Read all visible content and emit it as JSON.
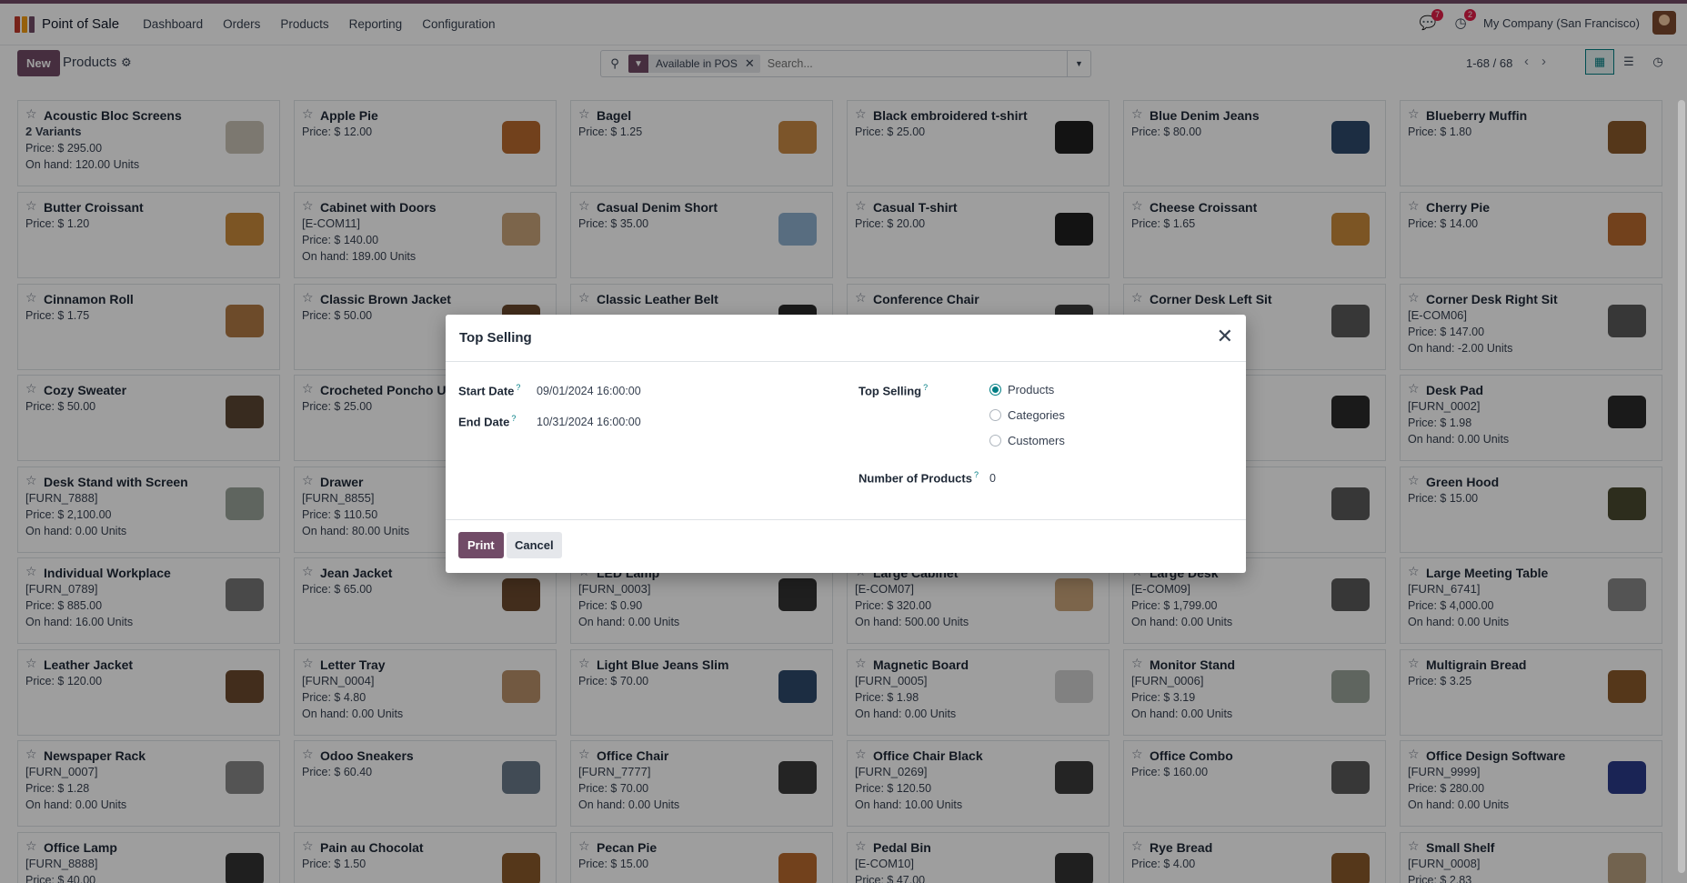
{
  "app": {
    "name": "Point of Sale",
    "nav": [
      "Dashboard",
      "Orders",
      "Products",
      "Reporting",
      "Configuration"
    ],
    "messages_badge": "7",
    "activity_badge": "2",
    "company": "My Company (San Francisco)"
  },
  "control": {
    "new_label": "New",
    "breadcrumb": "Products",
    "search_facet": "Available in POS",
    "search_placeholder": "Search...",
    "pager": "1-68 / 68"
  },
  "colors": {
    "brand": "#714B67",
    "accent": "#017e84"
  },
  "products": [
    {
      "name": "Acoustic Bloc Screens",
      "sub": "2 Variants",
      "sub_bold": true,
      "price": "Price: $ 295.00",
      "onhand": "On hand: 120.00 Units",
      "icon": "screen-icon"
    },
    {
      "name": "Apple Pie",
      "price": "Price: $ 12.00",
      "icon": "pie-icon"
    },
    {
      "name": "Bagel",
      "price": "Price: $ 1.25",
      "icon": "bagel-icon"
    },
    {
      "name": "Black embroidered t-shirt",
      "price": "Price: $ 25.00",
      "icon": "tshirt-icon"
    },
    {
      "name": "Blue Denim Jeans",
      "price": "Price: $ 80.00",
      "icon": "jeans-icon"
    },
    {
      "name": "Blueberry Muffin",
      "price": "Price: $ 1.80",
      "icon": "muffin-icon"
    },
    {
      "name": "Butter Croissant",
      "price": "Price: $ 1.20",
      "icon": "croissant-icon"
    },
    {
      "name": "Cabinet with Doors",
      "sub": "[E-COM11]",
      "price": "Price: $ 140.00",
      "onhand": "On hand: 189.00 Units",
      "icon": "cabinet-icon"
    },
    {
      "name": "Casual Denim Short",
      "price": "Price: $ 35.00",
      "icon": "shorts-icon"
    },
    {
      "name": "Casual T-shirt",
      "price": "Price: $ 20.00",
      "icon": "tshirt-icon"
    },
    {
      "name": "Cheese Croissant",
      "price": "Price: $ 1.65",
      "icon": "croissant-icon"
    },
    {
      "name": "Cherry Pie",
      "price": "Price: $ 14.00",
      "icon": "pie-icon"
    },
    {
      "name": "Cinnamon Roll",
      "price": "Price: $ 1.75",
      "icon": "roll-icon"
    },
    {
      "name": "Classic Brown Jacket",
      "price": "Price: $ 50.00",
      "icon": "jacket-icon"
    },
    {
      "name": "Classic Leather Belt",
      "price": "",
      "icon": "belt-icon"
    },
    {
      "name": "Conference Chair",
      "sub": "",
      "price": "",
      "icon": "chair-icon"
    },
    {
      "name": "Corner Desk Left Sit",
      "sub": "",
      "price": "",
      "icon": "desk-icon"
    },
    {
      "name": "Corner Desk Right Sit",
      "sub": "[E-COM06]",
      "price": "Price: $ 147.00",
      "onhand": "On hand: -2.00 Units",
      "icon": "desk-icon"
    },
    {
      "name": "Cozy Sweater",
      "price": "Price: $ 50.00",
      "icon": "sweater-icon"
    },
    {
      "name": "Crocheted Poncho Un",
      "price": "Price: $ 25.00",
      "icon": "poncho-icon"
    },
    {
      "name": "",
      "price": "",
      "icon": "blank"
    },
    {
      "name": "",
      "price": "",
      "icon": "blank"
    },
    {
      "name": "",
      "price": "",
      "icon": "organizer-icon"
    },
    {
      "name": "Desk Pad",
      "sub": "[FURN_0002]",
      "price": "Price: $ 1.98",
      "onhand": "On hand: 0.00 Units",
      "icon": "pad-icon"
    },
    {
      "name": "Desk Stand with Screen",
      "sub": "[FURN_7888]",
      "price": "Price: $ 2,100.00",
      "onhand": "On hand: 0.00 Units",
      "icon": "stand-icon"
    },
    {
      "name": "Drawer",
      "sub": "[FURN_8855]",
      "price": "Price: $ 110.50",
      "onhand": "On hand: 80.00 Units",
      "icon": "blank"
    },
    {
      "name": "",
      "price": "",
      "icon": "blank"
    },
    {
      "name": "",
      "price": "",
      "icon": "blank"
    },
    {
      "name": "",
      "price": "",
      "icon": "desk-icon"
    },
    {
      "name": "Green Hood",
      "price": "Price: $ 15.00",
      "icon": "hood-icon"
    },
    {
      "name": "Individual Workplace",
      "sub": "[FURN_0789]",
      "price": "Price: $ 885.00",
      "onhand": "On hand: 16.00 Units",
      "icon": "workplace-icon"
    },
    {
      "name": "Jean Jacket",
      "price": "Price: $ 65.00",
      "icon": "jacket-icon"
    },
    {
      "name": "LED Lamp",
      "sub": "[FURN_0003]",
      "price": "Price: $ 0.90",
      "onhand": "On hand: 0.00 Units",
      "icon": "lamp-icon"
    },
    {
      "name": "Large Cabinet",
      "sub": "[E-COM07]",
      "price": "Price: $ 320.00",
      "onhand": "On hand: 500.00 Units",
      "icon": "cabinet-icon"
    },
    {
      "name": "Large Desk",
      "sub": "[E-COM09]",
      "price": "Price: $ 1,799.00",
      "onhand": "On hand: 0.00 Units",
      "icon": "desk-icon"
    },
    {
      "name": "Large Meeting Table",
      "sub": "[FURN_6741]",
      "price": "Price: $ 4,000.00",
      "onhand": "On hand: 0.00 Units",
      "icon": "table-icon"
    },
    {
      "name": "Leather Jacket",
      "price": "Price: $ 120.00",
      "icon": "jacket-icon"
    },
    {
      "name": "Letter Tray",
      "sub": "[FURN_0004]",
      "price": "Price: $ 4.80",
      "onhand": "On hand: 0.00 Units",
      "icon": "tray-icon"
    },
    {
      "name": "Light Blue Jeans Slim",
      "price": "Price: $ 70.00",
      "icon": "jeans-icon"
    },
    {
      "name": "Magnetic Board",
      "sub": "[FURN_0005]",
      "price": "Price: $ 1.98",
      "onhand": "On hand: 0.00 Units",
      "icon": "board-icon"
    },
    {
      "name": "Monitor Stand",
      "sub": "[FURN_0006]",
      "price": "Price: $ 3.19",
      "onhand": "On hand: 0.00 Units",
      "icon": "stand-icon"
    },
    {
      "name": "Multigrain Bread",
      "price": "Price: $ 3.25",
      "icon": "bread-icon"
    },
    {
      "name": "Newspaper Rack",
      "sub": "[FURN_0007]",
      "price": "Price: $ 1.28",
      "onhand": "On hand: 0.00 Units",
      "icon": "rack-icon"
    },
    {
      "name": "Odoo Sneakers",
      "price": "Price: $ 60.40",
      "icon": "sneakers-icon"
    },
    {
      "name": "Office Chair",
      "sub": "[FURN_7777]",
      "price": "Price: $ 70.00",
      "onhand": "On hand: 0.00 Units",
      "icon": "chair-icon"
    },
    {
      "name": "Office Chair Black",
      "sub": "[FURN_0269]",
      "price": "Price: $ 120.50",
      "onhand": "On hand: 10.00 Units",
      "icon": "chair-icon"
    },
    {
      "name": "Office Combo",
      "price": "Price: $ 160.00",
      "icon": "desk-icon"
    },
    {
      "name": "Office Design Software",
      "sub": "[FURN_9999]",
      "price": "Price: $ 280.00",
      "onhand": "On hand: 0.00 Units",
      "icon": "software-icon"
    },
    {
      "name": "Office Lamp",
      "sub": "[FURN_8888]",
      "price": "Price: $ 40.00",
      "icon": "lamp-icon"
    },
    {
      "name": "Pain au Chocolat",
      "price": "Price: $ 1.50",
      "icon": "bread-icon"
    },
    {
      "name": "Pecan Pie",
      "price": "Price: $ 15.00",
      "icon": "pie-icon"
    },
    {
      "name": "Pedal Bin",
      "sub": "[E-COM10]",
      "price": "Price: $ 47.00",
      "icon": "bin-icon"
    },
    {
      "name": "Rye Bread",
      "price": "Price: $ 4.00",
      "icon": "bread-icon"
    },
    {
      "name": "Small Shelf",
      "sub": "[FURN_0008]",
      "price": "Price: $ 2.83",
      "icon": "shelf-icon"
    }
  ],
  "dialog": {
    "title": "Top Selling",
    "start_date_label": "Start Date",
    "start_date": "09/01/2024 16:00:00",
    "end_date_label": "End Date",
    "end_date": "10/31/2024 16:00:00",
    "top_selling_label": "Top Selling",
    "options": [
      "Products",
      "Categories",
      "Customers"
    ],
    "selected": "Products",
    "num_products_label": "Number of Products",
    "num_products": "0",
    "help_mark": "?",
    "print_label": "Print",
    "cancel_label": "Cancel"
  }
}
